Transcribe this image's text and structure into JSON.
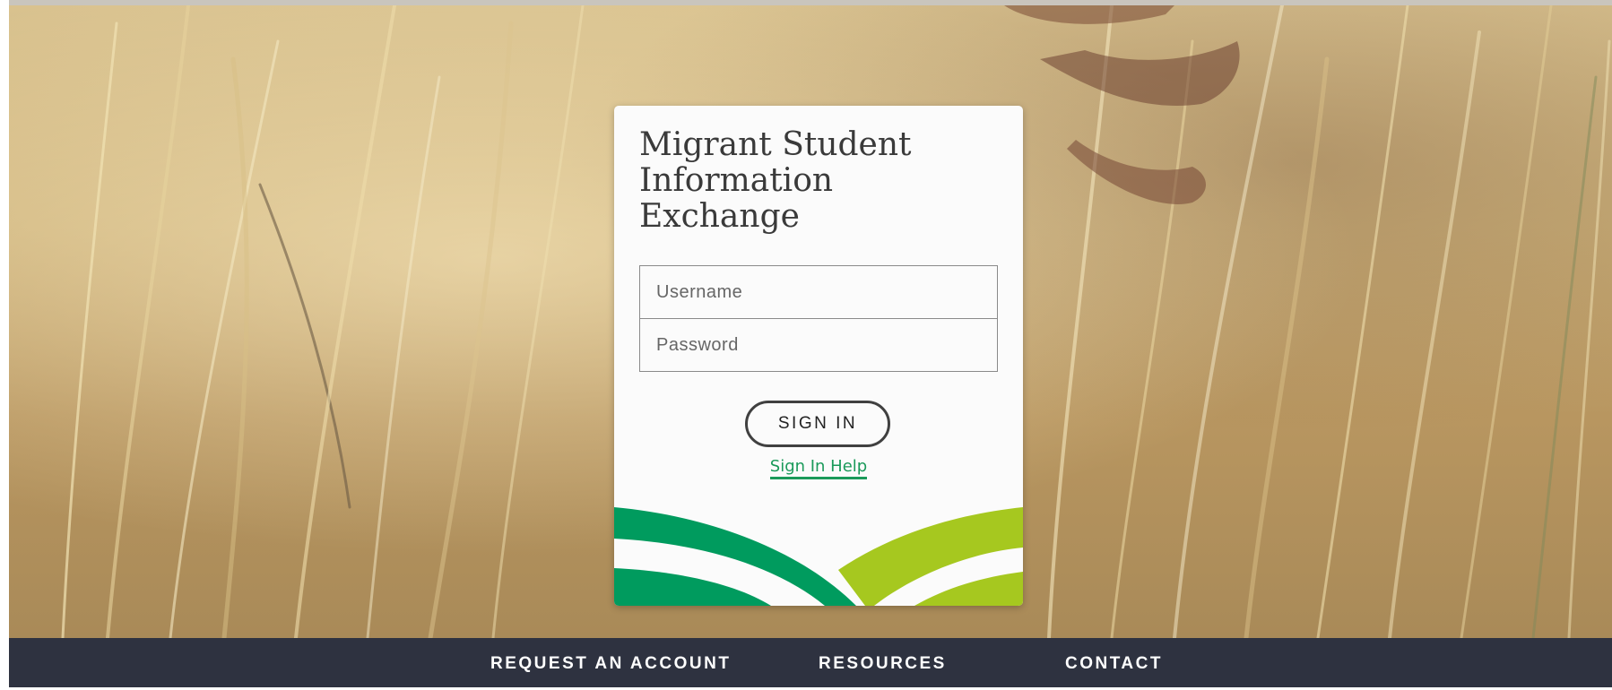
{
  "app": {
    "title": "Migrant Student Information Exchange"
  },
  "login": {
    "username_placeholder": "Username",
    "password_placeholder": "Password",
    "signin_label": "SIGN IN",
    "help_label": "Sign In Help"
  },
  "footer": {
    "links": [
      {
        "label": "REQUEST AN ACCOUNT"
      },
      {
        "label": "RESOURCES"
      },
      {
        "label": "CONTACT"
      }
    ]
  },
  "colors": {
    "footer_bg": "#2e3240",
    "link_green": "#1a9a5a",
    "logo_green": "#009b5e",
    "logo_lime": "#a6c81f",
    "card_bg": "#fbfbfb"
  },
  "background": {
    "image": "wheat-field-photo"
  }
}
